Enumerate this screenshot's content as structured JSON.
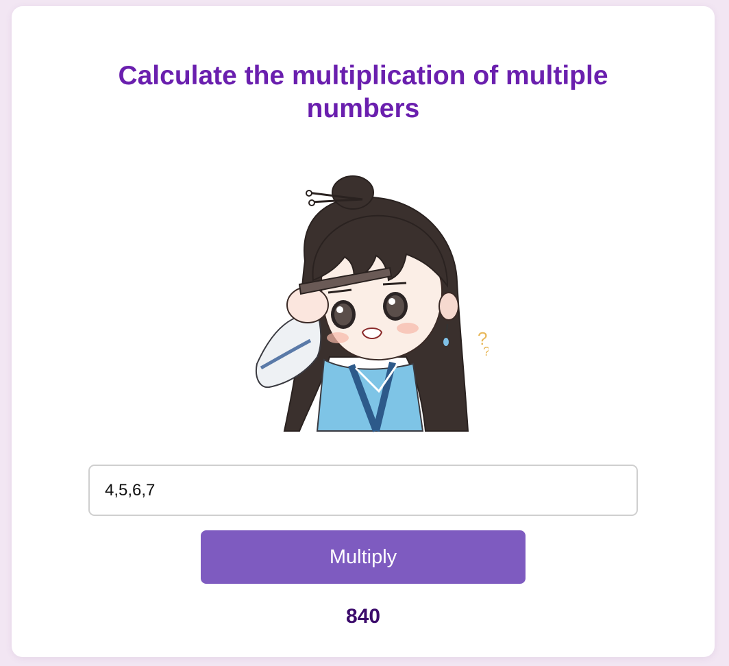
{
  "page": {
    "title": "Calculate the multiplication of multiple numbers"
  },
  "mascot": {
    "description_icon": "chibi-girl-confused-illustration"
  },
  "form": {
    "numbers_value": "4,5,6,7",
    "multiply_label": "Multiply"
  },
  "result": {
    "value": "840"
  },
  "colors": {
    "background": "#f2e6f3",
    "title": "#6a1fae",
    "button": "#7e5bc0",
    "result": "#3b0a6b"
  }
}
